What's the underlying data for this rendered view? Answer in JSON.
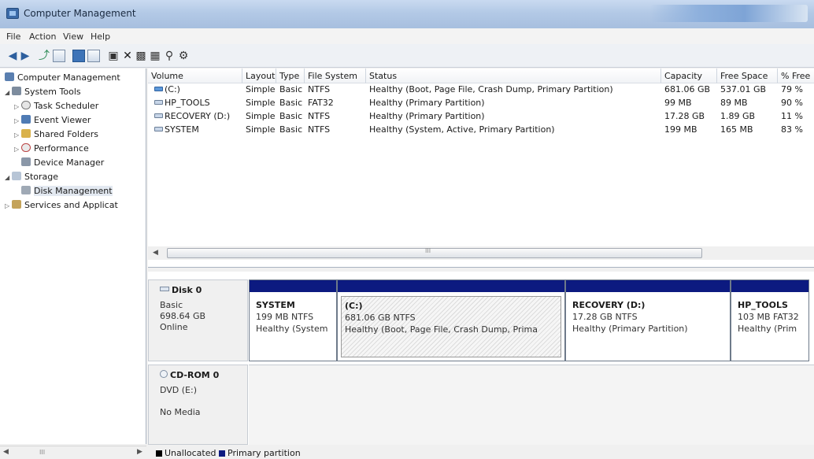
{
  "window": {
    "title": "Computer Management"
  },
  "menu": [
    "File",
    "Action",
    "View",
    "Help"
  ],
  "toolbar": {
    "icons": [
      "back-icon",
      "forward-icon",
      "up-folder-icon",
      "console-tree-icon",
      "properties-icon",
      "help-icon",
      "refresh-icon",
      "export-icon",
      "delete-icon",
      "new-volume-icon",
      "open-icon",
      "search-icon",
      "disk-settings-icon"
    ]
  },
  "tree": {
    "items": [
      {
        "label": "Computer Management",
        "icon": "computer-management-icon"
      },
      {
        "label": "System Tools",
        "icon": "tools-icon"
      },
      {
        "label": "Task Scheduler",
        "icon": "clock-icon"
      },
      {
        "label": "Event Viewer",
        "icon": "event-viewer-icon"
      },
      {
        "label": "Shared Folders",
        "icon": "shared-folder-icon"
      },
      {
        "label": "Performance",
        "icon": "performance-icon"
      },
      {
        "label": "Device Manager",
        "icon": "device-manager-icon"
      },
      {
        "label": "Storage",
        "icon": "storage-icon"
      },
      {
        "label": "Disk Management",
        "icon": "disk-management-icon"
      },
      {
        "label": "Services and Applicat",
        "icon": "services-icon"
      }
    ]
  },
  "list": {
    "columns": [
      "Volume",
      "Layout",
      "Type",
      "File System",
      "Status",
      "Capacity",
      "Free Space",
      "% Free"
    ],
    "rows": [
      [
        "(C:)",
        "Simple",
        "Basic",
        "NTFS",
        "Healthy (Boot, Page File, Crash Dump, Primary Partition)",
        "681.06 GB",
        "537.01 GB",
        "79 %"
      ],
      [
        "HP_TOOLS",
        "Simple",
        "Basic",
        "FAT32",
        "Healthy (Primary Partition)",
        "99 MB",
        "89 MB",
        "90 %"
      ],
      [
        "RECOVERY (D:)",
        "Simple",
        "Basic",
        "NTFS",
        "Healthy (Primary Partition)",
        "17.28 GB",
        "1.89 GB",
        "11 %"
      ],
      [
        "SYSTEM",
        "Simple",
        "Basic",
        "NTFS",
        "Healthy (System, Active, Primary Partition)",
        "199 MB",
        "165 MB",
        "83 %"
      ]
    ],
    "scroll_grip": "III"
  },
  "disks": [
    {
      "name": "Disk 0",
      "type": "Basic",
      "size": "698.64 GB",
      "status": "Online",
      "partitions": [
        {
          "name": "SYSTEM",
          "fs": "199 MB NTFS",
          "status": "Healthy (System"
        },
        {
          "name": "(C:)",
          "fs": "681.06 GB NTFS",
          "status": "Healthy (Boot, Page File, Crash Dump, Prima"
        },
        {
          "name": "RECOVERY  (D:)",
          "fs": "17.28 GB NTFS",
          "status": "Healthy (Primary Partition)"
        },
        {
          "name": "HP_TOOLS",
          "fs": "103 MB FAT32",
          "status": "Healthy (Prim"
        }
      ]
    },
    {
      "name": "CD-ROM 0",
      "type": "DVD (E:)",
      "status": "No Media"
    }
  ],
  "legend": [
    {
      "label": "Unallocated",
      "color": "#000000"
    },
    {
      "label": "Primary partition",
      "color": "#0c1a80"
    }
  ],
  "left_scroll_grip": "III"
}
